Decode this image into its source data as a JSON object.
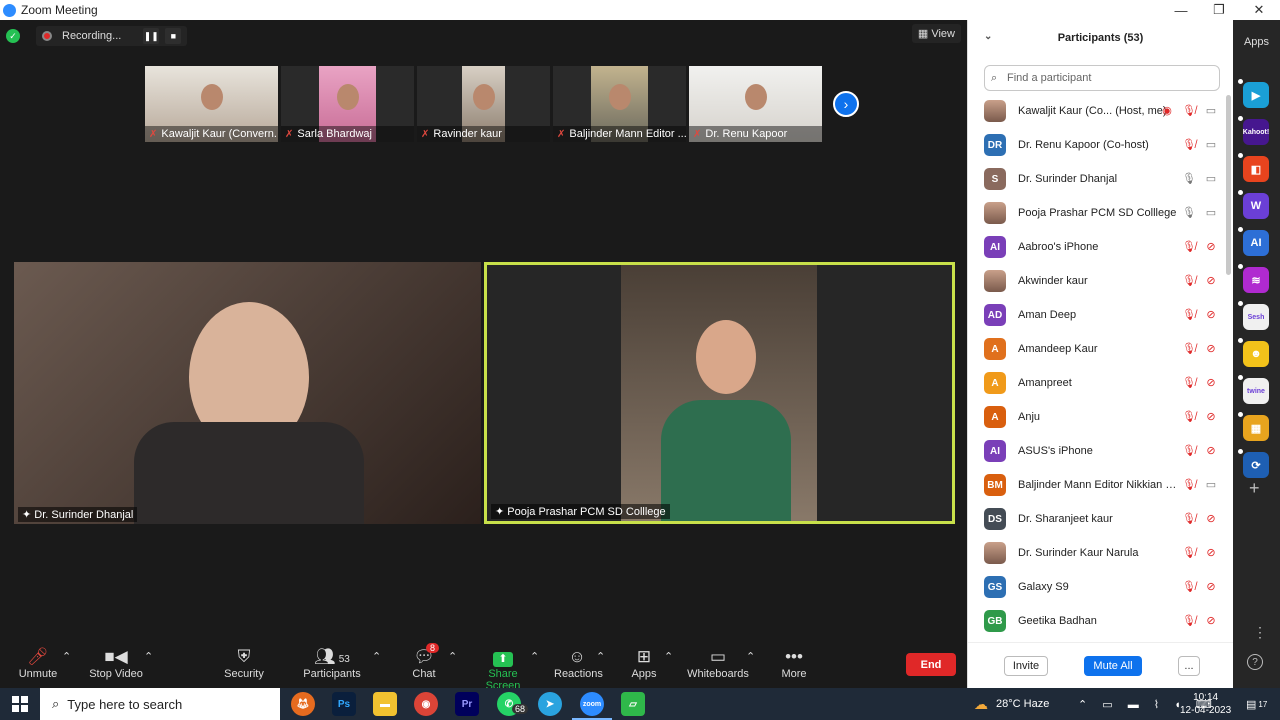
{
  "window": {
    "title": "Zoom Meeting"
  },
  "recording": {
    "label": "Recording..."
  },
  "view_label": "View",
  "thumbnails": [
    {
      "name": "Kawaljit Kaur (Convern..."
    },
    {
      "name": "Sarla Bhardwaj"
    },
    {
      "name": "Ravinder kaur"
    },
    {
      "name": "Baljinder Mann Editor ..."
    },
    {
      "name": "Dr. Renu Kapoor"
    }
  ],
  "main_tiles": [
    {
      "name": "Dr. Surinder Dhanjal"
    },
    {
      "name": "Pooja Prashar PCM SD Colllege"
    }
  ],
  "toolbar": {
    "unmute": "Unmute",
    "stop_video": "Stop Video",
    "security": "Security",
    "participants": "Participants",
    "participants_count": "53",
    "chat": "Chat",
    "chat_badge": "8",
    "share_screen": "Share Screen",
    "reactions": "Reactions",
    "apps": "Apps",
    "whiteboards": "Whiteboards",
    "more": "More",
    "end": "End"
  },
  "panel": {
    "title": "Participants (53)",
    "search_placeholder": "Find a participant",
    "participants": [
      {
        "name": "Kawaljit Kaur (Co...  (Host, me)",
        "avatar": "",
        "color": "",
        "mic": "off",
        "video": "on",
        "recording": true
      },
      {
        "name": "Dr. Renu Kapoor (Co-host)",
        "avatar": "DR",
        "color": "#2d6fb3",
        "mic": "off",
        "video": "on"
      },
      {
        "name": "Dr. Surinder Dhanjal",
        "avatar": "S",
        "color": "#8a6a5e",
        "mic": "on",
        "video": "on"
      },
      {
        "name": "Pooja Prashar PCM SD Colllege",
        "avatar": "",
        "color": "",
        "mic": "on",
        "video": "on"
      },
      {
        "name": "Aabroo's iPhone",
        "avatar": "AI",
        "color": "#7a3fb8",
        "mic": "off",
        "video": "off"
      },
      {
        "name": "Akwinder kaur",
        "avatar": "",
        "color": "",
        "mic": "off",
        "video": "off"
      },
      {
        "name": "Aman Deep",
        "avatar": "AD",
        "color": "#7a3fb8",
        "mic": "off",
        "video": "off"
      },
      {
        "name": "Amandeep Kaur",
        "avatar": "A",
        "color": "#e0701d",
        "mic": "off",
        "video": "off"
      },
      {
        "name": "Amanpreet",
        "avatar": "A",
        "color": "#f09a1a",
        "mic": "off",
        "video": "off"
      },
      {
        "name": "Anju",
        "avatar": "A",
        "color": "#d95f0e",
        "mic": "off",
        "video": "off"
      },
      {
        "name": "ASUS's iPhone",
        "avatar": "AI",
        "color": "#7a3fb8",
        "mic": "off",
        "video": "off"
      },
      {
        "name": "Baljinder Mann Editor Nikkian Ka...",
        "avatar": "BM",
        "color": "#d95f0e",
        "mic": "off",
        "video": "on"
      },
      {
        "name": "Dr. Sharanjeet kaur",
        "avatar": "DS",
        "color": "#444c55",
        "mic": "off",
        "video": "off"
      },
      {
        "name": "Dr. Surinder Kaur Narula",
        "avatar": "",
        "color": "",
        "mic": "off",
        "video": "off"
      },
      {
        "name": "Galaxy S9",
        "avatar": "GS",
        "color": "#2d6fb3",
        "mic": "off",
        "video": "off"
      },
      {
        "name": "Geetika Badhan",
        "avatar": "GB",
        "color": "#2f9a4a",
        "mic": "off",
        "video": "off"
      }
    ],
    "invite": "Invite",
    "mute_all": "Mute All",
    "more": "..."
  },
  "sidebar": {
    "label": "Apps",
    "apps": [
      {
        "icon": "arrow-app-icon",
        "color": "#1a9fd6",
        "text": "▶"
      },
      {
        "icon": "kahoot-icon",
        "color": "#46178f",
        "text": "Kahoot!"
      },
      {
        "icon": "red-app-icon",
        "color": "#e8441e",
        "text": "◧"
      },
      {
        "icon": "w-app-icon",
        "color": "#6b3fd6",
        "text": "W"
      },
      {
        "icon": "ai-app-icon",
        "color": "#2d6fd6",
        "text": "AI"
      },
      {
        "icon": "wave-app-icon",
        "color": "#b02ad0",
        "text": "≋"
      },
      {
        "icon": "sesh-icon",
        "color": "#f0f0f0",
        "text": "Sesh"
      },
      {
        "icon": "emoji-app-icon",
        "color": "#f2c21a",
        "text": "☻"
      },
      {
        "icon": "twine-icon",
        "color": "#f0f0f0",
        "text": "twine"
      },
      {
        "icon": "grid-app-icon",
        "color": "#e8a41e",
        "text": "▦"
      },
      {
        "icon": "sync-app-icon",
        "color": "#1e5fb3",
        "text": "⟳"
      }
    ]
  },
  "taskbar": {
    "search_placeholder": "Type here to search",
    "whatsapp_badge": "68",
    "weather": "28°C  Haze",
    "time": "10:14",
    "date": "12-04-2023",
    "notif_count": "17"
  }
}
